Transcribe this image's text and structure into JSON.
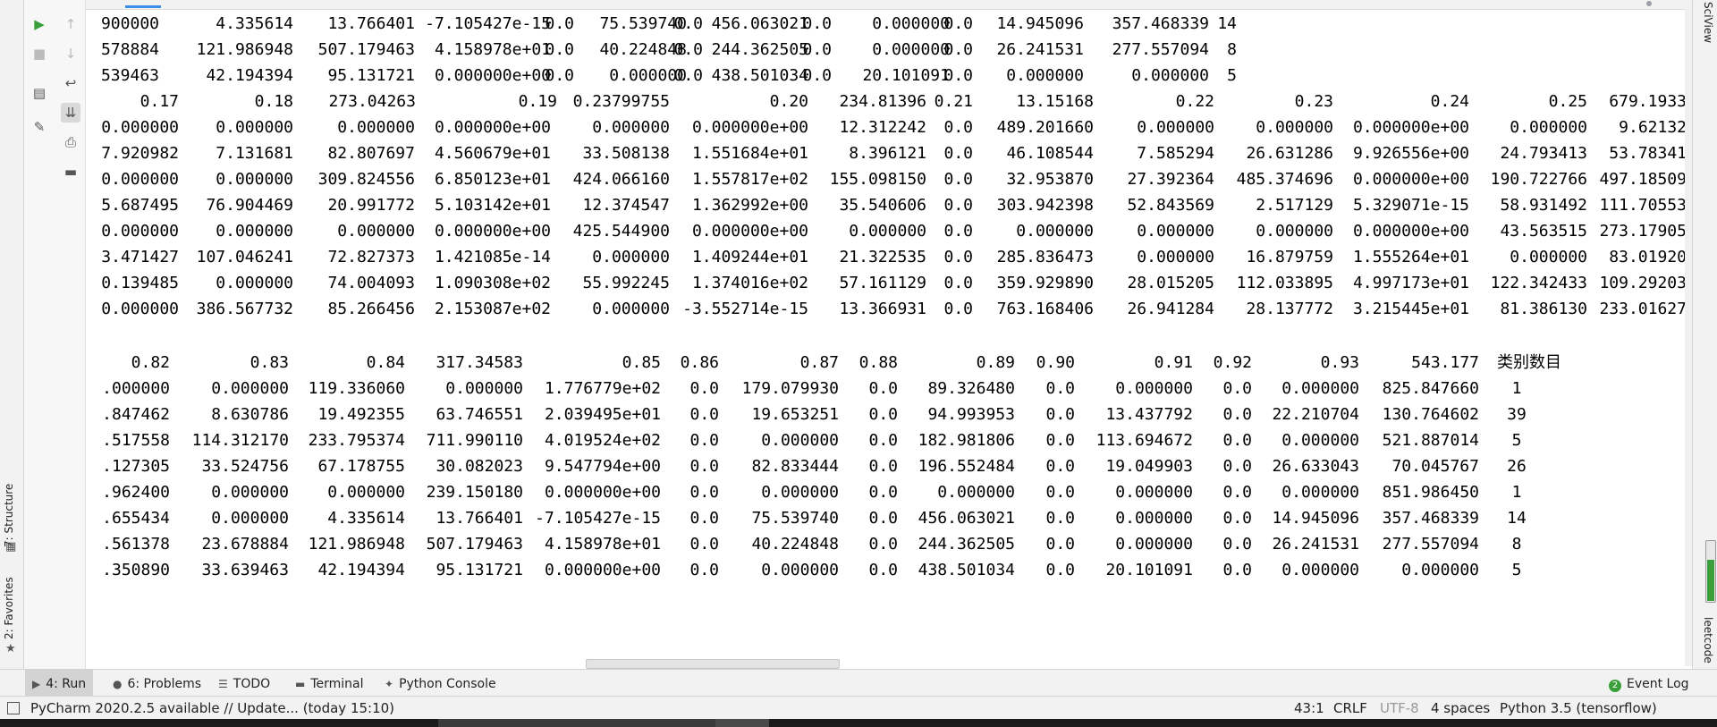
{
  "run_toolbar": {
    "icons": [
      "run-icon",
      "stop-icon",
      "up-arrow-icon",
      "down-arrow-icon",
      "soft-wrap-icon",
      "layout-icon",
      "scroll-to-end-icon",
      "pin-icon",
      "print-icon",
      "trash-icon"
    ]
  },
  "left_rail": {
    "structure_label": "7: Structure",
    "favorites_label": "2: Favorites"
  },
  "right_rail": {
    "sciview_label": "SciView",
    "leetcode_label": "leetcode",
    "meter_level": 0.7
  },
  "console": {
    "table1": {
      "rows": [
        [
          "900000",
          "4.335614",
          "13.766401",
          "-7.105427e-15",
          "0.0",
          "75.539740",
          "0.0",
          "456.063021",
          "0.0",
          "0.000000",
          "0.0",
          "14.945096",
          "357.468339",
          "14"
        ],
        [
          "578884",
          "121.986948",
          "507.179463",
          "4.158978e+01",
          "0.0",
          "40.224848",
          "0.0",
          "244.362505",
          "0.0",
          "0.000000",
          "0.0",
          "26.241531",
          "277.557094",
          "8"
        ],
        [
          "539463",
          "42.194394",
          "95.131721",
          "0.000000e+00",
          "0.0",
          "0.000000",
          "0.0",
          "438.501034",
          "0.0",
          "20.101091",
          "0.0",
          "0.000000",
          "0.000000",
          "5"
        ],
        [
          "0.17",
          "0.18",
          "273.04263",
          "0.19",
          "0.23799755",
          "0.20",
          "234.81396",
          "0.21",
          "13.15168",
          "0.22",
          "0.23",
          "0.24",
          "0.25",
          "679.1933"
        ],
        [
          "0.000000",
          "0.000000",
          "0.000000",
          "0.000000e+00",
          "0.000000",
          "0.000000e+00",
          "12.312242",
          "0.0",
          "489.201660",
          "0.000000",
          "0.000000",
          "0.000000e+00",
          "0.000000",
          "9.62132"
        ],
        [
          "7.920982",
          "7.131681",
          "82.807697",
          "4.560679e+01",
          "33.508138",
          "1.551684e+01",
          "8.396121",
          "0.0",
          "46.108544",
          "7.585294",
          "26.631286",
          "9.926556e+00",
          "24.793413",
          "53.78341"
        ],
        [
          "0.000000",
          "0.000000",
          "309.824556",
          "6.850123e+01",
          "424.066160",
          "1.557817e+02",
          "155.098150",
          "0.0",
          "32.953870",
          "27.392364",
          "485.374696",
          "0.000000e+00",
          "190.722766",
          "497.18509"
        ],
        [
          "5.687495",
          "76.904469",
          "20.991772",
          "5.103142e+01",
          "12.374547",
          "1.362992e+00",
          "35.540606",
          "0.0",
          "303.942398",
          "52.843569",
          "2.517129",
          "5.329071e-15",
          "58.931492",
          "111.70553"
        ],
        [
          "0.000000",
          "0.000000",
          "0.000000",
          "0.000000e+00",
          "425.544900",
          "0.000000e+00",
          "0.000000",
          "0.0",
          "0.000000",
          "0.000000",
          "0.000000",
          "0.000000e+00",
          "43.563515",
          "273.17905"
        ],
        [
          "3.471427",
          "107.046241",
          "72.827373",
          "1.421085e-14",
          "0.000000",
          "1.409244e+01",
          "21.322535",
          "0.0",
          "285.836473",
          "0.000000",
          "16.879759",
          "1.555264e+01",
          "0.000000",
          "83.01920"
        ],
        [
          "0.139485",
          "0.000000",
          "74.004093",
          "1.090308e+02",
          "55.992245",
          "1.374016e+02",
          "57.161129",
          "0.0",
          "359.929890",
          "28.015205",
          "112.033895",
          "4.997173e+01",
          "122.342433",
          "109.29203"
        ],
        [
          "0.000000",
          "386.567732",
          "85.266456",
          "2.153087e+02",
          "0.000000",
          "-3.552714e-15",
          "13.366931",
          "0.0",
          "763.168406",
          "26.941284",
          "28.137772",
          "3.215445e+01",
          "81.386130",
          "233.01627"
        ]
      ]
    },
    "table2": {
      "headers": [
        "0.82",
        "0.83",
        "0.84",
        "317.34583",
        "0.85",
        "0.86",
        "0.87",
        "0.88",
        "0.89",
        "0.90",
        "0.91",
        "0.92",
        "0.93",
        "543.177",
        "类别数目"
      ],
      "rows": [
        [
          ".000000",
          "0.000000",
          "119.336060",
          "0.000000",
          "1.776779e+02",
          "0.0",
          "179.079930",
          "0.0",
          "89.326480",
          "0.0",
          "0.000000",
          "0.0",
          "0.000000",
          "825.847660",
          "1"
        ],
        [
          ".847462",
          "8.630786",
          "19.492355",
          "63.746551",
          "2.039495e+01",
          "0.0",
          "19.653251",
          "0.0",
          "94.993953",
          "0.0",
          "13.437792",
          "0.0",
          "22.210704",
          "130.764602",
          "39"
        ],
        [
          ".517558",
          "114.312170",
          "233.795374",
          "711.990110",
          "4.019524e+02",
          "0.0",
          "0.000000",
          "0.0",
          "182.981806",
          "0.0",
          "113.694672",
          "0.0",
          "0.000000",
          "521.887014",
          "5"
        ],
        [
          ".127305",
          "33.524756",
          "67.178755",
          "30.082023",
          "9.547794e+00",
          "0.0",
          "82.833444",
          "0.0",
          "196.552484",
          "0.0",
          "19.049903",
          "0.0",
          "26.633043",
          "70.045767",
          "26"
        ],
        [
          ".962400",
          "0.000000",
          "0.000000",
          "239.150180",
          "0.000000e+00",
          "0.0",
          "0.000000",
          "0.0",
          "0.000000",
          "0.0",
          "0.000000",
          "0.0",
          "0.000000",
          "851.986450",
          "1"
        ],
        [
          ".655434",
          "0.000000",
          "4.335614",
          "13.766401",
          "-7.105427e-15",
          "0.0",
          "75.539740",
          "0.0",
          "456.063021",
          "0.0",
          "0.000000",
          "0.0",
          "14.945096",
          "357.468339",
          "14"
        ],
        [
          ".561378",
          "23.678884",
          "121.986948",
          "507.179463",
          "4.158978e+01",
          "0.0",
          "40.224848",
          "0.0",
          "244.362505",
          "0.0",
          "0.000000",
          "0.0",
          "26.241531",
          "277.557094",
          "8"
        ],
        [
          ".350890",
          "33.639463",
          "42.194394",
          "95.131721",
          "0.000000e+00",
          "0.0",
          "0.000000",
          "0.0",
          "438.501034",
          "0.0",
          "20.101091",
          "0.0",
          "0.000000",
          "0.000000",
          "5"
        ]
      ]
    }
  },
  "toolwindow_tabs": [
    {
      "label": "4: Run",
      "icon": "play-icon",
      "active": true
    },
    {
      "label": "6: Problems",
      "icon": "info-icon",
      "active": false
    },
    {
      "label": "TODO",
      "icon": "list-icon",
      "active": false
    },
    {
      "label": "Terminal",
      "icon": "terminal-icon",
      "active": false
    },
    {
      "label": "Python Console",
      "icon": "python-icon",
      "active": false
    }
  ],
  "event_log": {
    "label": "Event Log",
    "badge": "2"
  },
  "status_bar": {
    "message": "PyCharm 2020.2.5 available // Update... (today 15:10)",
    "position": "43:1",
    "line_separator": "CRLF",
    "encoding": "UTF-8",
    "indent": "4 spaces",
    "interpreter": "Python 3.5 (tensorflow)"
  }
}
